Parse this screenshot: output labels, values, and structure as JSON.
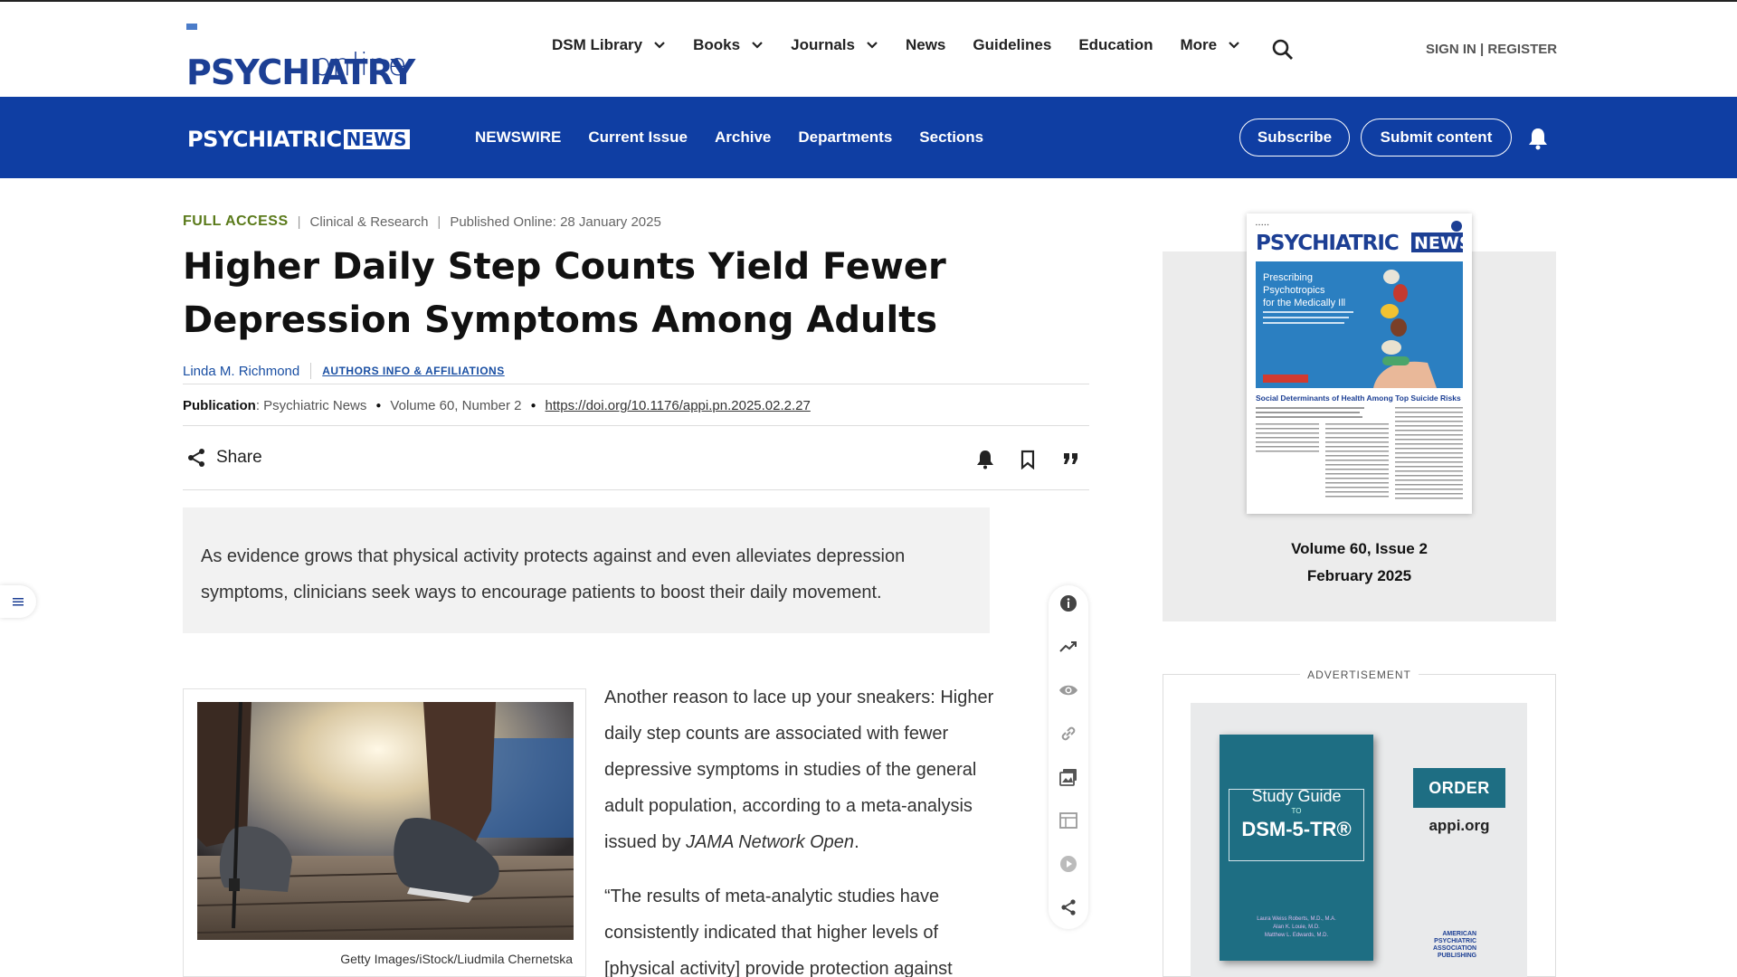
{
  "header": {
    "logo_top": "PSYCHIATRY",
    "logo_bottom": "online",
    "nav": [
      "DSM Library",
      "Books",
      "Journals",
      "News",
      "Guidelines",
      "Education",
      "More"
    ],
    "sign_in": "SIGN IN",
    "register": "REGISTER"
  },
  "subheader": {
    "logo_a": "PSYCHIATRIC",
    "logo_b": "NEWS",
    "nav": [
      "NEWSWIRE",
      "Current Issue",
      "Archive",
      "Departments",
      "Sections"
    ],
    "subscribe": "Subscribe",
    "submit": "Submit content"
  },
  "article": {
    "access": "FULL ACCESS",
    "section": "Clinical & Research",
    "published": "Published Online: 28 January 2025",
    "title": "Higher Daily Step Counts Yield Fewer Depression Symptoms Among Adults",
    "author": "Linda M. Richmond",
    "affiliations": "AUTHORS INFO & AFFILIATIONS",
    "publication_label": "Publication",
    "publication_value": ": Psychiatric News",
    "volume": "Volume 60, Number 2",
    "doi": "https://doi.org/10.1176/appi.pn.2025.02.2.27",
    "share": "Share",
    "abstract": "As evidence grows that physical activity protects against and even alleviates depression symptoms, clinicians seek ways to encourage patients to boost their daily movement.",
    "caption": "Getty Images/iStock/Liudmila Chernetska",
    "para1_a": "Another reason to lace up your sneakers: Higher daily step counts are associated with fewer depressive symptoms in studies of the general adult population, according to a meta-analysis issued by ",
    "para1_journal": "JAMA Network Open",
    "para1_end": ".",
    "para2": "“The results of meta-analytic studies have consistently indicated that higher levels of [physical activity] provide protection against"
  },
  "sidebar": {
    "cover_title": "Prescribing Psychotropics for the Medically Ill",
    "cover_headline": "Social Determinants of Health Among Top Suicide Risks",
    "volume": "Volume 60, Issue 2",
    "date": "February 2025",
    "ad_label": "ADVERTISEMENT",
    "ad_book_line1": "Study Guide",
    "ad_book_line2": "TO",
    "ad_book_line3": "DSM-5-TR®",
    "ad_book_authors": "Laura Weiss Roberts, M.D., M.A.\nAlan K. Louie, M.D.\nMatthew L. Edwards, M.D.",
    "ad_order": "ORDER",
    "ad_site": "appi.org"
  },
  "colors": {
    "brand_blue": "#0f3ea3",
    "full_access_green": "#5a7a1a",
    "link_blue": "#1a4fa3"
  }
}
